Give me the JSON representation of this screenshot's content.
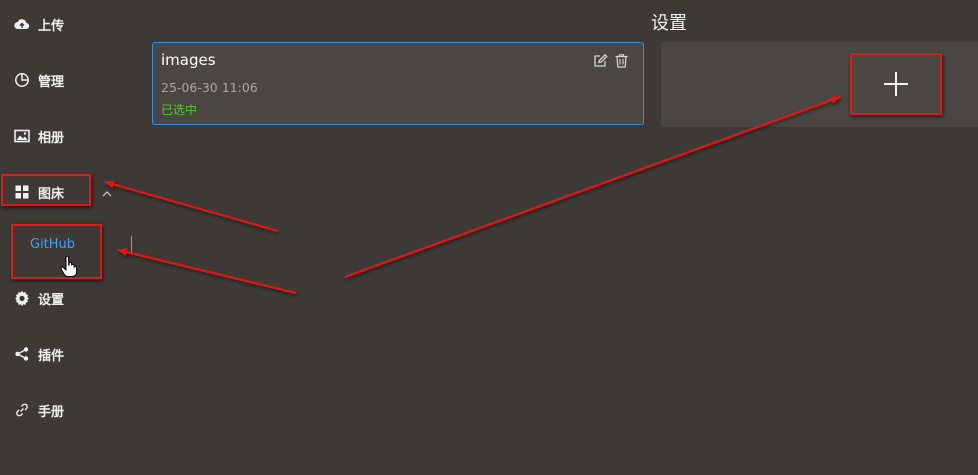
{
  "sidebar": {
    "items": [
      {
        "label": "上传",
        "icon": "cloud-upload-icon"
      },
      {
        "label": "管理",
        "icon": "pie-chart-icon"
      },
      {
        "label": "相册",
        "icon": "image-icon"
      },
      {
        "label": "图床",
        "icon": "grid-icon"
      },
      {
        "label": "设置",
        "icon": "gear-icon"
      },
      {
        "label": "插件",
        "icon": "share-icon"
      },
      {
        "label": "手册",
        "icon": "link-icon"
      }
    ],
    "submenu": {
      "label": "GitHub"
    }
  },
  "main": {
    "title": "设置",
    "card": {
      "name": "images",
      "date": "25-06-30 11:06",
      "status": "已选中"
    }
  },
  "colors": {
    "background": "#3d3a36",
    "card_border": "#3b8ee6",
    "selected_link": "#3fa0ff",
    "status_green": "#55c23a",
    "annotation_red": "#e01818"
  }
}
